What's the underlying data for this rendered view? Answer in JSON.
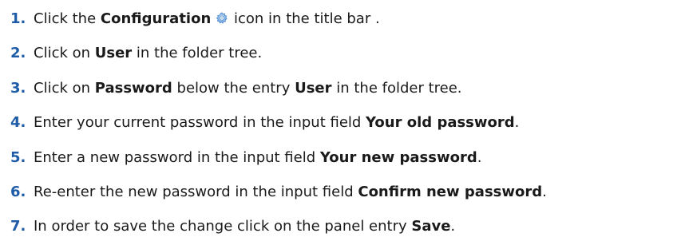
{
  "steps": [
    {
      "number": "1.",
      "t1": "Click the ",
      "b1": "Configuration",
      "t2": " icon in the title bar .",
      "icon": "gear-icon"
    },
    {
      "number": "2.",
      "t1": "Click on ",
      "b1": "User",
      "t2": " in the folder tree."
    },
    {
      "number": "3.",
      "t1": "Click on ",
      "b1": "Password",
      "t2": " below the entry ",
      "b2": "User",
      "t3": " in the folder tree."
    },
    {
      "number": "4.",
      "t1": "Enter your current password in the input field ",
      "b1": "Your old password",
      "t2": "."
    },
    {
      "number": "5.",
      "t1": "Enter a new password in the input field ",
      "b1": "Your new password",
      "t2": "."
    },
    {
      "number": "6.",
      "t1": "Re-enter the new password in the input field ",
      "b1": "Confirm new password",
      "t2": "."
    },
    {
      "number": "7.",
      "t1": "In order to save the change click on the panel entry ",
      "b1": "Save",
      "t2": "."
    }
  ],
  "colors": {
    "step_number": "#1e5ca8",
    "text": "#1a1a1a",
    "icon_blue": "#4a8fd8"
  }
}
